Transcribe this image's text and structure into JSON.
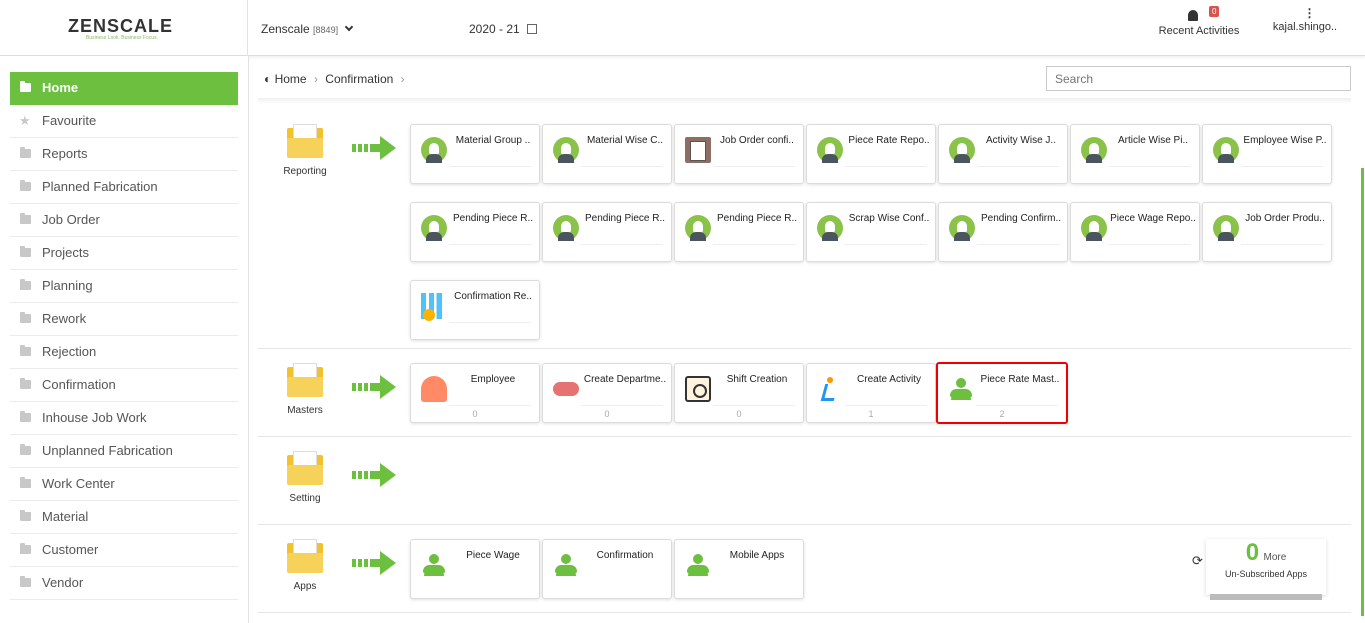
{
  "brand": {
    "logo_text": "ZENSCALE",
    "tagline": "Business Look. Business Focus."
  },
  "header": {
    "company": "Zenscale",
    "company_code": "[8849]",
    "fiscal_year": "2020 - 21",
    "recent_label": "Recent Activities",
    "recent_count": "0",
    "user": "kajal.shingo.."
  },
  "sidebar": {
    "items": [
      {
        "label": "Home"
      },
      {
        "label": "Favourite"
      },
      {
        "label": "Reports"
      },
      {
        "label": "Planned Fabrication"
      },
      {
        "label": "Job Order"
      },
      {
        "label": "Projects"
      },
      {
        "label": "Planning"
      },
      {
        "label": "Rework"
      },
      {
        "label": "Rejection"
      },
      {
        "label": "Confirmation"
      },
      {
        "label": "Inhouse Job Work"
      },
      {
        "label": "Unplanned Fabrication"
      },
      {
        "label": "Work Center"
      },
      {
        "label": "Material"
      },
      {
        "label": "Customer"
      },
      {
        "label": "Vendor"
      }
    ]
  },
  "breadcrumb": {
    "home": "Home",
    "current": "Confirmation"
  },
  "search": {
    "placeholder": "Search"
  },
  "sections": {
    "reporting": {
      "label": "Reporting",
      "cards": [
        {
          "title": "Material Group ..",
          "icon": "face-icon"
        },
        {
          "title": "Material Wise C..",
          "icon": "face-icon"
        },
        {
          "title": "Job Order confi..",
          "icon": "job-order-icon"
        },
        {
          "title": "Piece Rate Repo..",
          "icon": "face-icon"
        },
        {
          "title": "Activity Wise J..",
          "icon": "face-icon"
        },
        {
          "title": "Article Wise Pi..",
          "icon": "face-icon"
        },
        {
          "title": "Employee Wise P..",
          "icon": "face-icon"
        },
        {
          "title": "Pending Piece R..",
          "icon": "face-icon"
        },
        {
          "title": "Pending Piece R..",
          "icon": "face-icon"
        },
        {
          "title": "Pending Piece R..",
          "icon": "face-icon"
        },
        {
          "title": "Scrap Wise Conf..",
          "icon": "face-icon"
        },
        {
          "title": "Pending Confirm..",
          "icon": "face-icon"
        },
        {
          "title": "Piece Wage Repo..",
          "icon": "face-icon"
        },
        {
          "title": "Job Order Produ..",
          "icon": "face-icon"
        },
        {
          "title": "Confirmation Re..",
          "icon": "chart-gear-icon"
        }
      ]
    },
    "masters": {
      "label": "Masters",
      "cards": [
        {
          "title": "Employee",
          "count": "0",
          "icon": "employee-icon"
        },
        {
          "title": "Create Departme..",
          "count": "0",
          "icon": "department-icon"
        },
        {
          "title": "Shift Creation",
          "count": "0",
          "icon": "shift-clock-icon"
        },
        {
          "title": "Create Activity",
          "count": "1",
          "icon": "running-icon"
        },
        {
          "title": "Piece Rate Mast..",
          "count": "2",
          "icon": "person-icon"
        }
      ]
    },
    "setting": {
      "label": "Setting"
    },
    "apps": {
      "label": "Apps",
      "cards": [
        {
          "title": "Piece Wage",
          "icon": "person-icon"
        },
        {
          "title": "Confirmation",
          "icon": "person-icon"
        },
        {
          "title": "Mobile Apps",
          "icon": "person-icon"
        }
      ],
      "more_count": "0",
      "more_label": "More",
      "unsubscribed_label": "Un-Subscribed Apps"
    }
  },
  "colors": {
    "accent": "#6cbf3f",
    "highlight": "#e00000"
  }
}
